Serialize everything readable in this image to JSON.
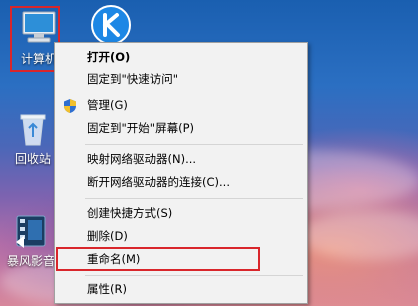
{
  "desktop": {
    "icons": [
      {
        "label": "计算机",
        "icon": "computer-icon"
      },
      {
        "label": "",
        "icon": "kugou-k-icon"
      },
      {
        "label": "回收站",
        "icon": "recycle-bin-icon"
      },
      {
        "label": "暴风影音",
        "icon": "baofeng-player-icon"
      }
    ]
  },
  "context_menu": {
    "items": [
      {
        "label": "打开(O)",
        "bold": true
      },
      {
        "label": "固定到\"快速访问\""
      },
      {
        "label": "管理(G)",
        "icon": "uac-shield-icon"
      },
      {
        "label": "固定到\"开始\"屏幕(P)"
      },
      {
        "label": "映射网络驱动器(N)..."
      },
      {
        "label": "断开网络驱动器的连接(C)..."
      },
      {
        "label": "创建快捷方式(S)"
      },
      {
        "label": "删除(D)"
      },
      {
        "label": "重命名(M)"
      },
      {
        "label": "属性(R)"
      }
    ]
  },
  "colors": {
    "highlight_box": "#d9262b",
    "menu_background": "#f2f2f2"
  }
}
